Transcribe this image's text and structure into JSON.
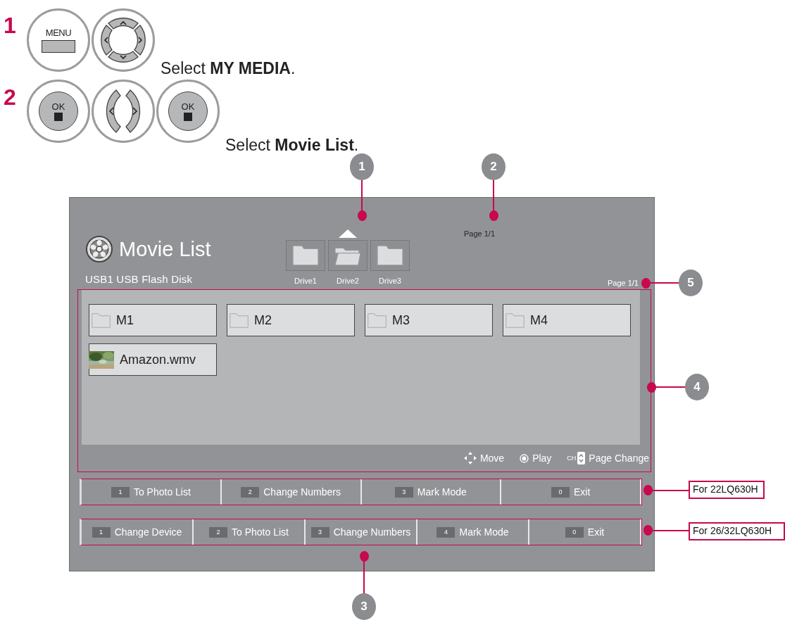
{
  "steps": [
    {
      "number": "1",
      "keys": [
        {
          "kind": "menu",
          "label": "MENU"
        },
        {
          "kind": "dpad"
        }
      ],
      "text": "Select **MY MEDIA**."
    },
    {
      "number": "2",
      "keys": [
        {
          "kind": "ok",
          "label": "OK"
        },
        {
          "kind": "leftright"
        },
        {
          "kind": "ok",
          "label": "OK"
        }
      ],
      "text": "Select **Movie List**."
    }
  ],
  "screen": {
    "title": "Movie List",
    "device": "USB1 USB Flash Disk",
    "drives": [
      {
        "label": "Drive1",
        "selected": false
      },
      {
        "label": "Drive2",
        "selected": true
      },
      {
        "label": "Drive3",
        "selected": false
      }
    ],
    "top_page": "Page 1/1",
    "page": "Page 1/1",
    "items": [
      {
        "kind": "folder",
        "label": "M1"
      },
      {
        "kind": "folder",
        "label": "M2"
      },
      {
        "kind": "folder",
        "label": "M3"
      },
      {
        "kind": "folder",
        "label": "M4"
      },
      {
        "kind": "video",
        "label": "Amazon.wmv"
      }
    ],
    "hints": [
      {
        "kind": "move",
        "label": "Move"
      },
      {
        "kind": "play",
        "label": "Play"
      },
      {
        "kind": "page",
        "key": "CH",
        "label": "Page Change"
      }
    ],
    "bars": [
      {
        "note": "For 22LQ630H",
        "buttons": [
          {
            "key": "1",
            "label": "To Photo List"
          },
          {
            "key": "2",
            "label": "Change Numbers"
          },
          {
            "key": "3",
            "label": "Mark Mode"
          },
          {
            "key": "0",
            "label": "Exit"
          }
        ]
      },
      {
        "note": "For 26/32LQ630H",
        "buttons": [
          {
            "key": "1",
            "label": "Change Device"
          },
          {
            "key": "2",
            "label": "To Photo List"
          },
          {
            "key": "3",
            "label": "Change Numbers"
          },
          {
            "key": "4",
            "label": "Mark Mode"
          },
          {
            "key": "0",
            "label": "Exit"
          }
        ]
      }
    ]
  },
  "callouts": [
    {
      "number": "1"
    },
    {
      "number": "2"
    },
    {
      "number": "3"
    },
    {
      "number": "4"
    },
    {
      "number": "5"
    }
  ]
}
